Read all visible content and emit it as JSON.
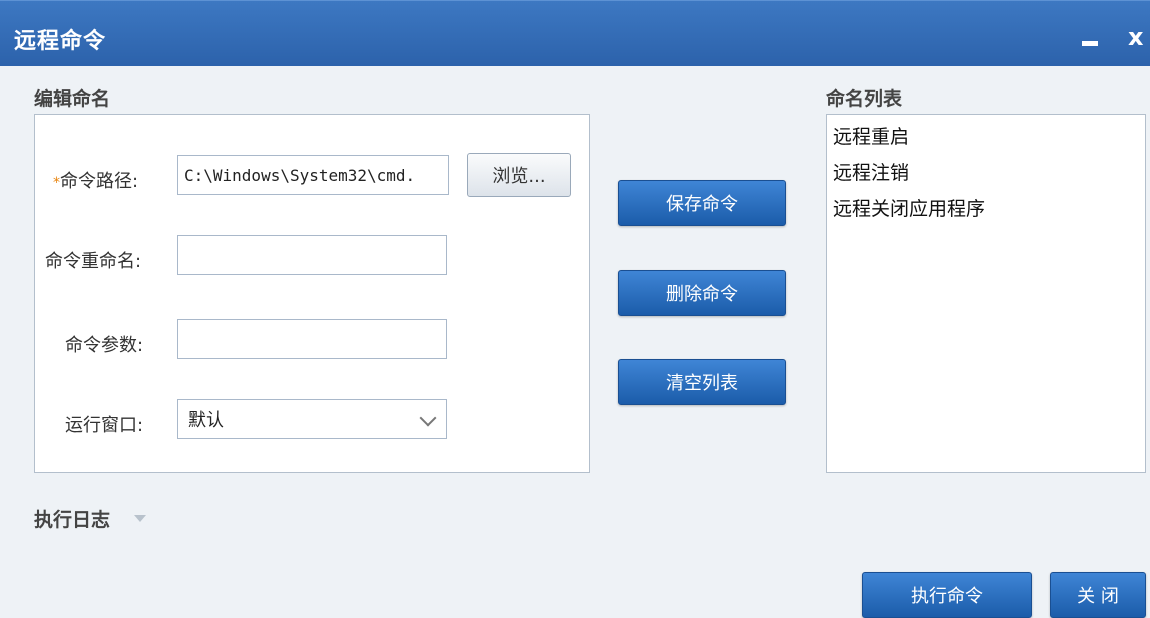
{
  "window": {
    "title": "远程命令",
    "minimize_icon": "minimize-icon",
    "close_icon": "close-icon",
    "close_glyph": "x"
  },
  "edit": {
    "section_label": "编辑命名",
    "required_mark": "*",
    "path_label": "命令路径:",
    "path_value": "C:\\Windows\\System32\\cmd.",
    "browse_label": "浏览...",
    "rename_label": "命令重命名:",
    "rename_value": "",
    "args_label": "命令参数:",
    "args_value": "",
    "window_label": "运行窗口:",
    "window_selected": "默认"
  },
  "actions": {
    "save_label": "保存命令",
    "delete_label": "删除命令",
    "clear_label": "清空列表"
  },
  "list": {
    "section_label": "命名列表",
    "items": [
      "远程重启",
      "远程注销",
      "远程关闭应用程序"
    ]
  },
  "log": {
    "label": "执行日志"
  },
  "footer": {
    "execute_label": "执行命令",
    "close_label": "关 闭"
  },
  "colors": {
    "titlebar": "#2c62ab",
    "button_blue": "#2a6dbf",
    "required": "#e8830c"
  }
}
